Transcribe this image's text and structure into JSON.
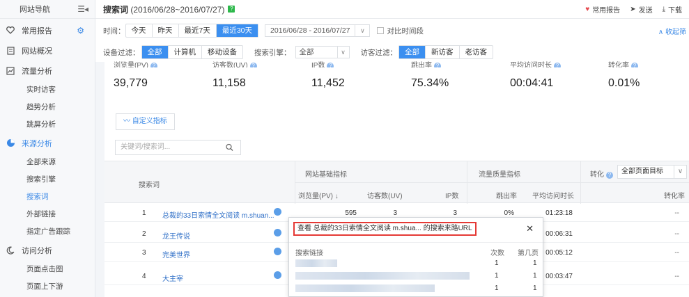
{
  "sidebar": {
    "header": "网站导航",
    "toggle": "☰◂",
    "sections": [
      {
        "key": "fav",
        "label": "常用报告",
        "icon": "heart-outline-icon",
        "gear": "⚙"
      },
      {
        "key": "overview",
        "label": "网站概况",
        "icon": "document-icon"
      },
      {
        "key": "traffic",
        "label": "流量分析",
        "icon": "chart-icon",
        "items": [
          "实时访客",
          "趋势分析",
          "跳屏分析"
        ]
      },
      {
        "key": "source",
        "label": "来源分析",
        "icon": "pie-icon",
        "items": [
          "全部来源",
          "搜索引擎",
          "搜索词",
          "外部链接",
          "指定广告跟踪"
        ]
      },
      {
        "key": "visit",
        "label": "访问分析",
        "icon": "moon-icon",
        "items": [
          "页面点击图",
          "页面上下游"
        ]
      }
    ]
  },
  "header": {
    "title": "搜索词",
    "range": "(2016/06/28~2016/07/27)",
    "help": "?",
    "actions": {
      "favorite": "常用报告",
      "send": "发送",
      "download": "下载"
    }
  },
  "filters": {
    "time_label": "时间：",
    "time_options": [
      "今天",
      "昨天",
      "最近7天",
      "最近30天"
    ],
    "time_selected": "最近30天",
    "date_range": "2016/06/28 - 2016/07/27",
    "compare_label": "对比时间段",
    "collapse": "∧ 收起筛",
    "device_label": "设备过滤：",
    "device_options": [
      "全部",
      "计算机",
      "移动设备"
    ],
    "device_selected": "全部",
    "engine_label": "搜索引擎：",
    "engine_value": "全部",
    "visitor_label": "访客过滤：",
    "visitor_options": [
      "全部",
      "新访客",
      "老访客"
    ],
    "visitor_selected": "全部"
  },
  "metrics": [
    {
      "label": "浏览量(PV)",
      "value": "39,779"
    },
    {
      "label": "访客数(UV)",
      "value": "11,158"
    },
    {
      "label": "IP数",
      "value": "11,452"
    },
    {
      "label": "跳出率",
      "value": "75.34%"
    },
    {
      "label": "平均访问时长",
      "value": "00:04:41"
    },
    {
      "label": "转化率",
      "value": "0.01%"
    }
  ],
  "panel": {
    "custom_button": "自定义指标",
    "search_placeholder": "关键词/搜索词..."
  },
  "table": {
    "col_keyword": "搜索词",
    "group_basic": "网站基础指标",
    "group_quality": "流量质量指标",
    "group_conversion": "转化",
    "goal_select": "全部页面目标",
    "cols": [
      "浏览量(PV)",
      "访客数(UV)",
      "IP数",
      "跳出率",
      "平均访问时长",
      "转化率"
    ],
    "sort_arrow": "↓",
    "rows": [
      {
        "idx": "1",
        "keyword": "总裁的33日索情全文阅读 m.shuan...",
        "pv": "595",
        "uv": "3",
        "ip": "3",
        "bounce": "0%",
        "duration": "01:23:18",
        "conv": "--"
      },
      {
        "idx": "2",
        "keyword": "龙王传说",
        "pv": "",
        "uv": "",
        "ip": "",
        "bounce": "",
        "duration": "00:06:31",
        "conv": "--"
      },
      {
        "idx": "3",
        "keyword": "完美世界",
        "pv": "",
        "uv": "",
        "ip": "",
        "bounce": "",
        "duration": "00:05:12",
        "conv": "--"
      },
      {
        "idx": "4",
        "keyword": "大主宰",
        "pv": "",
        "uv": "",
        "ip": "",
        "bounce": "",
        "duration": "00:03:47",
        "conv": "--"
      }
    ]
  },
  "popup": {
    "title": "查看  总裁的33日索情全文阅读 m.shua... 的搜索来路URL",
    "close": "✕",
    "col_link": "搜索链接",
    "col_count": "次数",
    "col_page": "第几页",
    "rows": [
      {
        "count": "1",
        "page": "1"
      },
      {
        "count": "1",
        "page": "1"
      },
      {
        "count": "1",
        "page": "1"
      }
    ]
  }
}
